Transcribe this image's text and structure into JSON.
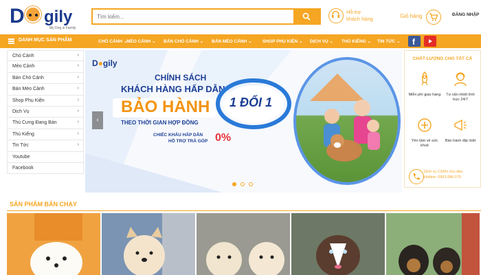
{
  "header": {
    "logo_tagline": "My Dog is Family",
    "search_placeholder": "Tìm kiếm...",
    "support_line1": "Hỗ trợ",
    "support_line2": "khách hàng",
    "cart_label": "Giỏ hàng",
    "login_label": "ĐĂNG NHẬP"
  },
  "nav": {
    "category_label": "DANH MỤC SẢN PHẨM",
    "items": [
      "CHÓ CẢNH",
      "MÈO CẢNH",
      "BÁN CHÓ CẢNH",
      "BÁN MÈO CẢNH",
      "SHOP PHỤ KIỆN",
      "DỊCH VỤ",
      "THỦ KIỂNG",
      "TIN TỨC"
    ]
  },
  "sidebar": {
    "items": [
      {
        "label": "Chó Cảnh",
        "arrow": "›"
      },
      {
        "label": "Mèo Cảnh",
        "arrow": "›"
      },
      {
        "label": "Bán Chó Cảnh",
        "arrow": "›"
      },
      {
        "label": "Bán Mèo Cảnh",
        "arrow": "›"
      },
      {
        "label": "Shop Phụ Kiện",
        "arrow": "›"
      },
      {
        "label": "Dịch Vụ",
        "arrow": "›"
      },
      {
        "label": "Thú Cưng Đang Bán",
        "arrow": "›"
      },
      {
        "label": "Thú Kiểng",
        "arrow": "›"
      },
      {
        "label": "Tin Tức",
        "arrow": "›"
      },
      {
        "label": "Youtube",
        "arrow": ""
      },
      {
        "label": "Facebook",
        "arrow": ""
      }
    ]
  },
  "banner": {
    "line1": "CHÍNH SÁCH",
    "line2": "KHÁCH HÀNG HẤP DẪN",
    "line3": "BẢO HÀNH",
    "line4": "THEO THỜI GIAN HỢP ĐỒNG",
    "line5": "CHIẾC KHẤU HẤP DẪN",
    "line6": "HỖ TRỢ TRẢ GÓP",
    "percent": "0%",
    "badge": "1 ĐỔI 1"
  },
  "right_panel": {
    "title": "CHẤT LƯỢNG CHO TẤT CẢ",
    "features": [
      {
        "label": "Miễn phí giao hàng",
        "icon": "rocket-icon"
      },
      {
        "label": "Tư vấn nhiệt tình trực 24/7",
        "icon": "support-agent-icon"
      },
      {
        "label": "Yên tâm về sức khoẻ",
        "icon": "medical-icon"
      },
      {
        "label": "Bảo hành đặc biệt",
        "icon": "megaphone-icon"
      }
    ],
    "hotline_line1": "Dịch vụ CSKH chu đáo",
    "hotline_line2": "Hotline: 0963.086.079"
  },
  "best_seller": {
    "title": "SẢN PHẨM BÁN CHẠY"
  },
  "colors": {
    "accent": "#f5a623",
    "brand": "#1b3a8c"
  }
}
